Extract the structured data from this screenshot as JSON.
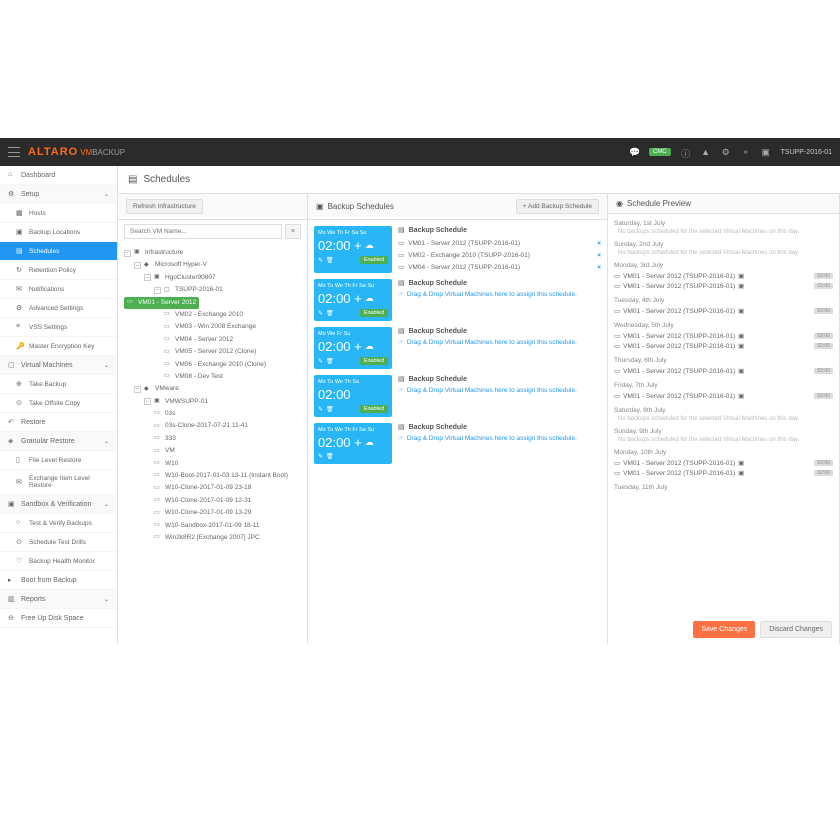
{
  "brand": {
    "name": "ALTARO",
    "product_prefix": "VM",
    "product_suffix": "BACKUP"
  },
  "topbar": {
    "cmc": "CMC",
    "host": "TSUPP-2016-01"
  },
  "sidebar": [
    {
      "label": "Dashboard",
      "ico": "⌂",
      "type": "item"
    },
    {
      "label": "Setup",
      "ico": "⚙",
      "type": "header"
    },
    {
      "label": "Hosts",
      "ico": "▦",
      "type": "sub"
    },
    {
      "label": "Backup Locations",
      "ico": "▣",
      "type": "sub"
    },
    {
      "label": "Schedules",
      "ico": "▤",
      "type": "sub",
      "active": true
    },
    {
      "label": "Retention Policy",
      "ico": "↻",
      "type": "sub"
    },
    {
      "label": "Notifications",
      "ico": "✉",
      "type": "sub"
    },
    {
      "label": "Advanced Settings",
      "ico": "⚙",
      "type": "sub"
    },
    {
      "label": "VSS Settings",
      "ico": "≡",
      "type": "sub"
    },
    {
      "label": "Master Encryption Key",
      "ico": "🔑",
      "type": "sub"
    },
    {
      "label": "Virtual Machines",
      "ico": "▢",
      "type": "header"
    },
    {
      "label": "Take Backup",
      "ico": "⊕",
      "type": "sub"
    },
    {
      "label": "Take Offsite Copy",
      "ico": "⊙",
      "type": "sub"
    },
    {
      "label": "Restore",
      "ico": "↶",
      "type": "item"
    },
    {
      "label": "Granular Restore",
      "ico": "◈",
      "type": "header"
    },
    {
      "label": "File Level Restore",
      "ico": "▯",
      "type": "sub"
    },
    {
      "label": "Exchange Item Level Restore",
      "ico": "✉",
      "type": "sub"
    },
    {
      "label": "Sandbox & Verification",
      "ico": "▣",
      "type": "header"
    },
    {
      "label": "Test & Verify Backups",
      "ico": "○",
      "type": "sub"
    },
    {
      "label": "Schedule Test Drills",
      "ico": "⊙",
      "type": "sub"
    },
    {
      "label": "Backup Health Monitor",
      "ico": "♡",
      "type": "sub"
    },
    {
      "label": "Boot from Backup",
      "ico": "▸",
      "type": "item"
    },
    {
      "label": "Reports",
      "ico": "▥",
      "type": "header"
    },
    {
      "label": "Free Up Disk Space",
      "ico": "⊖",
      "type": "item"
    }
  ],
  "page": {
    "title": "Schedules",
    "refresh_btn": "Refresh Infrastructure",
    "search_placeholder": "Search VM Name..."
  },
  "tree": [
    {
      "label": "Infrastructure",
      "ind": 0,
      "tgl": "−",
      "ico": "▣"
    },
    {
      "label": "Microsoft Hyper-V",
      "ind": 1,
      "tgl": "−",
      "ico": "◆"
    },
    {
      "label": "HgoCluster90807",
      "ind": 2,
      "tgl": "−",
      "ico": "▣"
    },
    {
      "label": "TSUPP-2016-01",
      "ind": 3,
      "tgl": "−",
      "ico": "▢"
    },
    {
      "label": "VM01 - Server 2012",
      "ind": 4,
      "ico": "▭",
      "sel": true
    },
    {
      "label": "VM02 - Exchange 2010",
      "ind": 4,
      "ico": "▭"
    },
    {
      "label": "VM03 - Win 2008 Exchange",
      "ind": 4,
      "ico": "▭"
    },
    {
      "label": "VM04 - Server 2012",
      "ind": 4,
      "ico": "▭"
    },
    {
      "label": "VM05 - Server 2012 (Clone)",
      "ind": 4,
      "ico": "▭"
    },
    {
      "label": "VM06 - Exchange 2010 (Clone)",
      "ind": 4,
      "ico": "▭"
    },
    {
      "label": "VM08 - Dev Test",
      "ind": 4,
      "ico": "▭"
    },
    {
      "label": "VMware",
      "ind": 1,
      "tgl": "−",
      "ico": "◆"
    },
    {
      "label": "VMWSUPP-01",
      "ind": 2,
      "tgl": "−",
      "ico": "▣"
    },
    {
      "label": "03s",
      "ind": 3,
      "ico": "▭"
    },
    {
      "label": "03s-Clone-2017-07-21 11-41",
      "ind": 3,
      "ico": "▭"
    },
    {
      "label": "333",
      "ind": 3,
      "ico": "▭"
    },
    {
      "label": "VM",
      "ind": 3,
      "ico": "▭"
    },
    {
      "label": "W10",
      "ind": 3,
      "ico": "▭"
    },
    {
      "label": "W10-Boot-2017-01-03 13-11 (Instant Boot)",
      "ind": 3,
      "ico": "▭"
    },
    {
      "label": "W10-Clone-2017-01-09 23-18",
      "ind": 3,
      "ico": "▭"
    },
    {
      "label": "W10-Clone-2017-01-09 12-31",
      "ind": 3,
      "ico": "▭"
    },
    {
      "label": "W10-Clone-2017-01-09 13-29",
      "ind": 3,
      "ico": "▭"
    },
    {
      "label": "W10-Sandbox-2017-01-09 18-11",
      "ind": 3,
      "ico": "▭"
    },
    {
      "label": "Win2k8R2 [Exchange 2007] JPC",
      "ind": 3,
      "ico": "▭"
    }
  ],
  "col2": {
    "title": "Backup Schedules",
    "add_btn": "Add Backup Schedule",
    "drag_hint": "Drag & Drop Virtual Machines here to assign this schedule."
  },
  "schedules": [
    {
      "days": [
        "Mo",
        "",
        "We",
        "Th",
        "Fr",
        "Sa",
        "Su"
      ],
      "off": [
        1
      ],
      "time": "02:00",
      "cloud": true,
      "enabled": true,
      "title": "Backup Schedule",
      "vms": [
        {
          "label": "VM01 - Server 2012 (TSUPP-2016-01)"
        },
        {
          "label": "VM02 - Exchange 2010 (TSUPP-2016-01)"
        },
        {
          "label": "VM04 - Server 2012 (TSUPP-2016-01)"
        }
      ]
    },
    {
      "days": [
        "Mo",
        "Tu",
        "We",
        "Th",
        "Fr",
        "Sa",
        "Su"
      ],
      "off": [],
      "time": "02:00",
      "cloud": true,
      "enabled": true,
      "title": "Backup Schedule",
      "vms": []
    },
    {
      "days": [
        "Mo",
        "",
        "We",
        "",
        "Fr",
        "",
        "Su"
      ],
      "off": [
        1,
        3,
        5
      ],
      "time": "02:00",
      "cloud": true,
      "enabled": true,
      "title": "Backup Schedule",
      "vms": []
    },
    {
      "days": [
        "Mo",
        "Tu",
        "We",
        "Th",
        "Sa",
        ""
      ],
      "off": [
        5
      ],
      "time": "02:00",
      "cloud": false,
      "enabled": true,
      "title": "Backup Schedule",
      "vms": []
    },
    {
      "days": [
        "Mo",
        "Tu",
        "We",
        "Th",
        "Fr",
        "Sa",
        "Su"
      ],
      "off": [],
      "time": "02:00",
      "cloud": true,
      "enabled": false,
      "title": "Backup Schedule",
      "vms": []
    }
  ],
  "enabled_label": "Enabled",
  "col3": {
    "title": "Schedule Preview"
  },
  "preview": [
    {
      "day": "Saturday, 1st July",
      "empty": "No backups scheduled for the selected Virtual Machines on this day."
    },
    {
      "day": "Sunday, 2nd July",
      "empty": "No backups scheduled for the selected Virtual Machines on this day."
    },
    {
      "day": "Monday, 3rd July",
      "vms": [
        {
          "label": "VM01 - Server 2012 (TSUPP-2016-01)",
          "t": "02:00"
        },
        {
          "label": "VM01 - Server 2012 (TSUPP-2016-01)",
          "t": "02:00"
        }
      ]
    },
    {
      "day": "Tuesday, 4th July",
      "vms": [
        {
          "label": "VM01 - Server 2012 (TSUPP-2016-01)",
          "t": "02:00"
        }
      ]
    },
    {
      "day": "Wednesday, 5th July",
      "vms": [
        {
          "label": "VM01 - Server 2012 (TSUPP-2016-01)",
          "t": "02:00"
        },
        {
          "label": "VM01 - Server 2012 (TSUPP-2016-01)",
          "t": "02:00"
        }
      ]
    },
    {
      "day": "Thursday, 6th July",
      "vms": [
        {
          "label": "VM01 - Server 2012 (TSUPP-2016-01)",
          "t": "02:00"
        }
      ]
    },
    {
      "day": "Friday, 7th July",
      "vms": [
        {
          "label": "VM01 - Server 2012 (TSUPP-2016-01)",
          "t": "02:00"
        }
      ]
    },
    {
      "day": "Saturday, 8th July",
      "empty": "No backups scheduled for the selected Virtual Machines on this day."
    },
    {
      "day": "Sunday, 9th July",
      "empty": "No backups scheduled for the selected Virtual Machines on this day."
    },
    {
      "day": "Monday, 10th July",
      "vms": [
        {
          "label": "VM01 - Server 2012 (TSUPP-2016-01)",
          "t": "02:00"
        },
        {
          "label": "VM01 - Server 2012 (TSUPP-2016-01)",
          "t": "02:00"
        }
      ]
    },
    {
      "day": "Tuesday, 11th July"
    }
  ],
  "footer": {
    "save": "Save Changes",
    "discard": "Discard Changes"
  }
}
